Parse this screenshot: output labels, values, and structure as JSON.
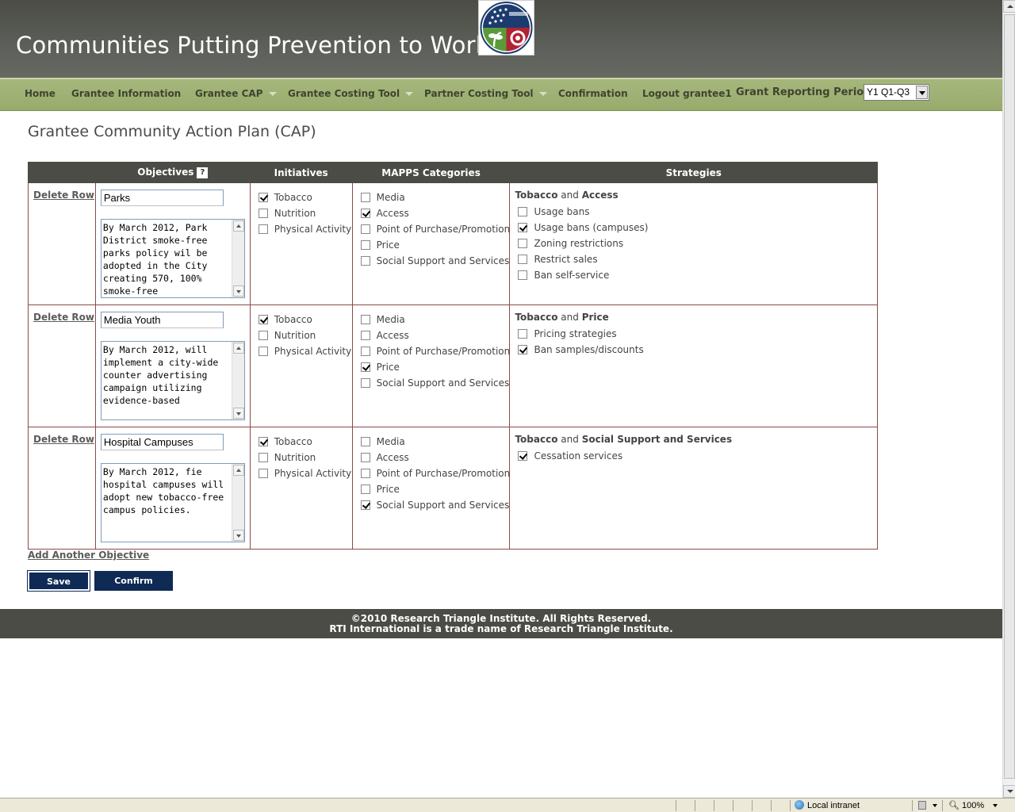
{
  "header": {
    "title": "Communities Putting Prevention to Work"
  },
  "nav": {
    "items": [
      {
        "label": "Home"
      },
      {
        "label": "Grantee Information"
      },
      {
        "label": "Grantee CAP"
      },
      {
        "label": "Grantee Costing Tool"
      },
      {
        "label": "Partner Costing Tool"
      },
      {
        "label": "Confirmation"
      },
      {
        "label": "Logout grantee1"
      }
    ],
    "period_label": "Grant Reporting Period:",
    "period_value": "Y1 Q1-Q3"
  },
  "page": {
    "title": "Grantee Community Action Plan (CAP)"
  },
  "table": {
    "headers": {
      "objectives": "Objectives",
      "help": "?",
      "initiatives": "Initiatives",
      "mapps": "MAPPS Categories",
      "strategies": "Strategies"
    },
    "rows": [
      {
        "delete": "Delete Row",
        "objective_name": "Parks",
        "objective_text": "By March 2012, Park District smoke-free parks policy wil be adopted in the City creating 570, 100% smoke-free",
        "initiatives": [
          {
            "label": "Tobacco",
            "checked": true
          },
          {
            "label": "Nutrition",
            "checked": false
          },
          {
            "label": "Physical Activity",
            "checked": false
          }
        ],
        "mapps": [
          {
            "label": "Media",
            "checked": false
          },
          {
            "label": "Access",
            "checked": true
          },
          {
            "label": "Point of Purchase/Promotion",
            "checked": false
          },
          {
            "label": "Price",
            "checked": false
          },
          {
            "label": "Social Support and Services",
            "checked": false
          }
        ],
        "strategy_init": "Tobacco",
        "strategy_and": "and",
        "strategy_cat": "Access",
        "strategies": [
          {
            "label": "Usage bans",
            "checked": false
          },
          {
            "label": "Usage bans (campuses)",
            "checked": true
          },
          {
            "label": "Zoning restrictions",
            "checked": false
          },
          {
            "label": "Restrict sales",
            "checked": false
          },
          {
            "label": "Ban self-service",
            "checked": false
          }
        ]
      },
      {
        "delete": "Delete Row",
        "objective_name": "Media Youth",
        "objective_text": "By March 2012, will implement a city-wide counter advertising campaign utilizing evidence-based",
        "initiatives": [
          {
            "label": "Tobacco",
            "checked": true
          },
          {
            "label": "Nutrition",
            "checked": false
          },
          {
            "label": "Physical Activity",
            "checked": false
          }
        ],
        "mapps": [
          {
            "label": "Media",
            "checked": false
          },
          {
            "label": "Access",
            "checked": false
          },
          {
            "label": "Point of Purchase/Promotion",
            "checked": false
          },
          {
            "label": "Price",
            "checked": true
          },
          {
            "label": "Social Support and Services",
            "checked": false
          }
        ],
        "strategy_init": "Tobacco",
        "strategy_and": "and",
        "strategy_cat": "Price",
        "strategies": [
          {
            "label": "Pricing strategies",
            "checked": false
          },
          {
            "label": "Ban samples/discounts",
            "checked": true
          }
        ]
      },
      {
        "delete": "Delete Row",
        "objective_name": "Hospital Campuses",
        "objective_text": "By March 2012, fie hospital campuses will adopt new tobacco-free campus policies.",
        "initiatives": [
          {
            "label": "Tobacco",
            "checked": true
          },
          {
            "label": "Nutrition",
            "checked": false
          },
          {
            "label": "Physical Activity",
            "checked": false
          }
        ],
        "mapps": [
          {
            "label": "Media",
            "checked": false
          },
          {
            "label": "Access",
            "checked": false
          },
          {
            "label": "Point of Purchase/Promotion",
            "checked": false
          },
          {
            "label": "Price",
            "checked": false
          },
          {
            "label": "Social Support and Services",
            "checked": true
          }
        ],
        "strategy_init": "Tobacco",
        "strategy_and": "and",
        "strategy_cat": "Social Support and Services",
        "strategies": [
          {
            "label": "Cessation services",
            "checked": true
          }
        ]
      }
    ]
  },
  "actions": {
    "add_objective": "Add Another Objective",
    "save": "Save",
    "confirm": "Confirm"
  },
  "footer": {
    "line1": "©2010 Research Triangle Institute. All Rights Reserved.",
    "line2": "RTI International is a trade name of Research Triangle Institute."
  },
  "statusbar": {
    "zone": "Local intranet",
    "zoom": "100%"
  },
  "colors": {
    "header_bg": "#4a4c45",
    "nav_bg": "#a6b77c",
    "button_bg": "#0f2a55",
    "row_border": "#8b4a4a"
  },
  "icons": {
    "logo": "recovery-gov-emblem",
    "help": "help-icon",
    "zone": "globe-icon",
    "zoom": "zoom-icon"
  }
}
